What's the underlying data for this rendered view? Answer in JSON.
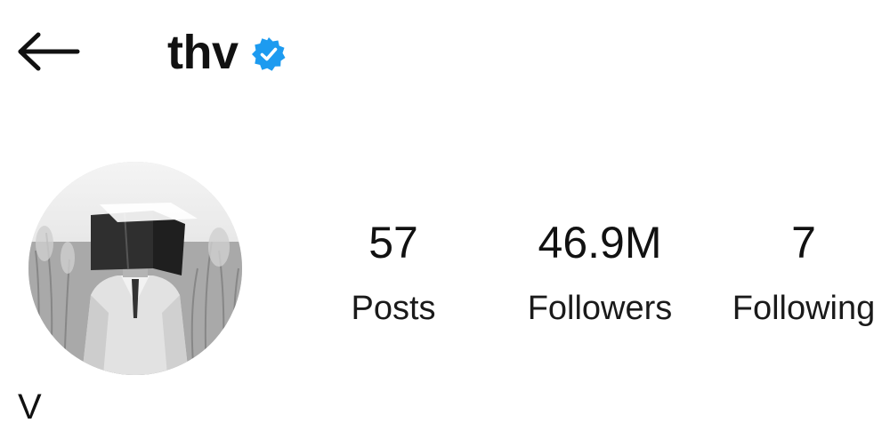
{
  "header": {
    "back_icon": "arrow-left-icon",
    "username": "thv",
    "verified_icon": "verified-badge-icon",
    "verified_color": "#1d9bf0"
  },
  "profile": {
    "avatar_icon": "profile-photo",
    "display_name": "V"
  },
  "stats": {
    "posts": {
      "value": "57",
      "label": "Posts"
    },
    "followers": {
      "value": "46.9M",
      "label": "Followers"
    },
    "following": {
      "value": "7",
      "label": "Following"
    }
  }
}
